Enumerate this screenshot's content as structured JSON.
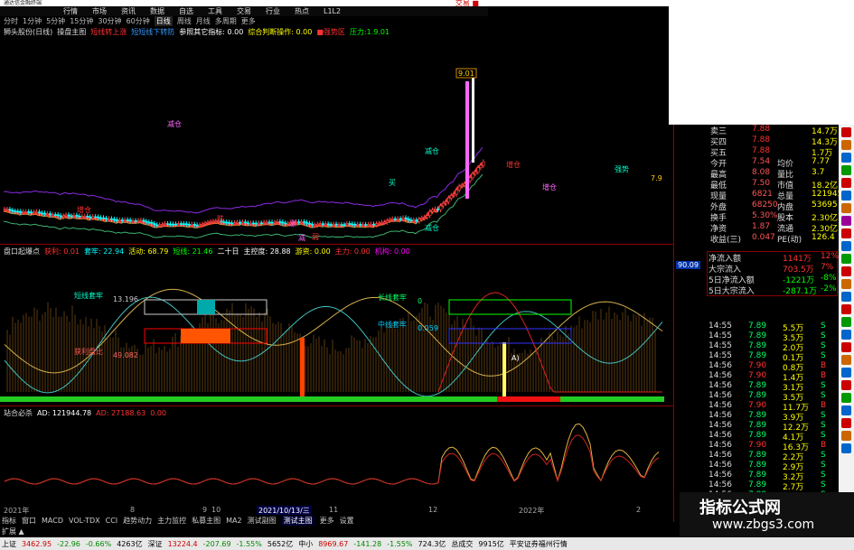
{
  "titlebar": {
    "title": "通达信金融终端",
    "right": "交易 ■"
  },
  "menu": [
    "行情",
    "市场",
    "资讯",
    "数据",
    "自选",
    "工具",
    "交易",
    "行业",
    "热点",
    "L1L2"
  ],
  "toolbar": [
    "分时",
    "1分钟",
    "5分钟",
    "15分钟",
    "30分钟",
    "60分钟",
    "日线",
    "周线",
    "月线",
    "多周期",
    "更多"
  ],
  "toolbar_active": 6,
  "ind1": [
    {
      "t": "狮头股份(日线)",
      "c": "#dddddd"
    },
    {
      "t": "操盘主图",
      "c": "#dddddd"
    },
    {
      "t": "短线转上涨",
      "c": "#ff3333"
    },
    {
      "t": "短短线下转防",
      "c": "#3399ff"
    },
    {
      "t": "参照其它指标: 0.00",
      "c": "#ffffff"
    },
    {
      "t": "综合判断操作: 0.00",
      "c": "#ffff00"
    },
    {
      "t": "■强势区",
      "c": "#ff3333"
    },
    {
      "t": "压力:1.9.01",
      "c": "#00ff00"
    }
  ],
  "ind2": [
    {
      "t": "盘口起爆点",
      "c": "#dddddd"
    },
    {
      "t": "获利: 0.01",
      "c": "#ff3333"
    },
    {
      "t": "套牢: 22.94",
      "c": "#00ffff"
    },
    {
      "t": "活动: 68.79",
      "c": "#ffff00"
    },
    {
      "t": "短线: 21.46",
      "c": "#00ff00"
    },
    {
      "t": "二十日",
      "c": "#ffffff"
    },
    {
      "t": "主控度: 28.88",
      "c": "#ffffff"
    },
    {
      "t": "游资: 0.00",
      "c": "#ffff00"
    },
    {
      "t": "主力: 0.00",
      "c": "#ff3333"
    },
    {
      "t": "机构: 0.00",
      "c": "#ff00ff"
    }
  ],
  "ind3": [
    {
      "t": "站合必杀",
      "c": "#dddddd"
    },
    {
      "t": "AD: 121944.78",
      "c": "#ffffff"
    },
    {
      "t": "AD: 27188.63",
      "c": "#ff3333"
    },
    {
      "t": "0.00",
      "c": "#ff3333"
    }
  ],
  "axis1": [
    "7.75",
    "7.50",
    "7.25",
    "7.00",
    "6.75",
    "6.50"
  ],
  "axis2": [
    "100.00",
    "80.00",
    "60.00",
    "40.00",
    "20.00",
    "0.00"
  ],
  "axis3": [
    "45000",
    "30000",
    "15000",
    "0"
  ],
  "axis2_badge": "90.09",
  "quote_rows": [
    {
      "l": "卖三",
      "v": "7.88",
      "v2": "14.7万",
      "lc": "#ccc",
      "vc": "#ff3333"
    },
    {
      "l": "买四",
      "v": "7.88",
      "v2": "14.3万",
      "lc": "#ccc",
      "vc": "#ff3333"
    },
    {
      "l": "买五",
      "v": "7.88",
      "v2": "1.7万",
      "lc": "#ccc",
      "vc": "#ff3333"
    },
    {
      "l": "今开",
      "v": "7.54",
      "l2": "均价",
      "v3": "7.77"
    },
    {
      "l": "最高",
      "v": "8.08",
      "l2": "量比",
      "v3": "3.7"
    },
    {
      "l": "最低",
      "v": "7.50",
      "l2": "市值",
      "v3": "18.2亿"
    },
    {
      "l": "现量",
      "v": "6821",
      "l2": "总量",
      "v3": "121945"
    },
    {
      "l": "外盘",
      "v": "68250",
      "l2": "内盘",
      "v3": "53695"
    },
    {
      "l": "换手",
      "v": "5.30%",
      "l2": "股本",
      "v3": "2.30亿"
    },
    {
      "l": "净资",
      "v": "1.87",
      "l2": "流通",
      "v3": "2.30亿"
    },
    {
      "l": "收益(三)",
      "v": "0.047",
      "l2": "PE(动)",
      "v3": "126.4"
    }
  ],
  "flow_rows": [
    {
      "l": "净流入额",
      "v": "1141万",
      "p": "12%",
      "vc": "#ff3333"
    },
    {
      "l": "大宗流入",
      "v": "703.5万",
      "p": "7%",
      "vc": "#ff3333"
    },
    {
      "l": "5日净流入额",
      "v": "-1221万",
      "p": "-8%",
      "vc": "#00ff00"
    },
    {
      "l": "5日大宗流入",
      "v": "-287.1万",
      "p": "-2%",
      "vc": "#00ff00"
    }
  ],
  "ticks": [
    {
      "t": "14:55",
      "p": "7.89",
      "v": "5.5万",
      "s": "S"
    },
    {
      "t": "14:55",
      "p": "7.89",
      "v": "3.5万",
      "s": "S"
    },
    {
      "t": "14:55",
      "p": "7.89",
      "v": "2.0万",
      "s": "S"
    },
    {
      "t": "14:55",
      "p": "7.89",
      "v": "0.1万",
      "s": "S"
    },
    {
      "t": "14:56",
      "p": "7.90",
      "v": "0.8万",
      "s": "B"
    },
    {
      "t": "14:56",
      "p": "7.90",
      "v": "1.4万",
      "s": "B"
    },
    {
      "t": "14:56",
      "p": "7.89",
      "v": "3.1万",
      "s": "S"
    },
    {
      "t": "14:56",
      "p": "7.89",
      "v": "3.5万",
      "s": "S"
    },
    {
      "t": "14:56",
      "p": "7.90",
      "v": "11.7万",
      "s": "B"
    },
    {
      "t": "14:56",
      "p": "7.89",
      "v": "3.9万",
      "s": "S"
    },
    {
      "t": "14:56",
      "p": "7.89",
      "v": "12.2万",
      "s": "S"
    },
    {
      "t": "14:56",
      "p": "7.89",
      "v": "4.1万",
      "s": "S"
    },
    {
      "t": "14:56",
      "p": "7.90",
      "v": "16.3万",
      "s": "B"
    },
    {
      "t": "14:56",
      "p": "7.89",
      "v": "2.2万",
      "s": "S"
    },
    {
      "t": "14:56",
      "p": "7.89",
      "v": "2.9万",
      "s": "S"
    },
    {
      "t": "14:56",
      "p": "7.89",
      "v": "3.2万",
      "s": "S"
    },
    {
      "t": "14:56",
      "p": "7.89",
      "v": "2.7万",
      "s": "S"
    },
    {
      "t": "14:56",
      "p": "7.89",
      "v": "2.5万",
      "s": "S"
    },
    {
      "t": "14:56",
      "p": "7.89",
      "v": "4.7万",
      "s": "S"
    }
  ],
  "dates": [
    "2021年",
    "8",
    "9",
    "10",
    "2021/10/13/三",
    "11",
    "12",
    "2022年",
    "2"
  ],
  "tabs": [
    "指标",
    "窗口",
    "MACD",
    "VOL-TDX",
    "CCI",
    "趋势动力",
    "主力监控",
    "私募主图",
    "MA2",
    "测试副图",
    "测试主图",
    "更多",
    "设置"
  ],
  "status": [
    {
      "t": "上证",
      "c": "#000"
    },
    {
      "t": "3462.95",
      "c": "#c00"
    },
    {
      "t": "-22.96",
      "c": "#080"
    },
    {
      "t": "-0.66%",
      "c": "#080"
    },
    {
      "t": "4263亿",
      "c": "#000"
    },
    {
      "t": "深证",
      "c": "#000"
    },
    {
      "t": "13224.4",
      "c": "#c00"
    },
    {
      "t": "-207.69",
      "c": "#080"
    },
    {
      "t": "-1.55%",
      "c": "#080"
    },
    {
      "t": "5652亿",
      "c": "#000"
    },
    {
      "t": "中小",
      "c": "#000"
    },
    {
      "t": "8969.67",
      "c": "#c00"
    },
    {
      "t": "-141.28",
      "c": "#080"
    },
    {
      "t": "-1.55%",
      "c": "#080"
    },
    {
      "t": "724.3亿",
      "c": "#000"
    },
    {
      "t": "总成交",
      "c": "#000"
    },
    {
      "t": "9915亿",
      "c": "#000"
    },
    {
      "t": "平安证券福州行情",
      "c": "#000"
    }
  ],
  "panel_labels": {
    "bottom_left": "扩展 ▲",
    "tab_right": "模板",
    "chart_labels": [
      "短线套牢",
      "获利盘比",
      "长线套牢",
      "中线套牢",
      "13.196",
      "49.082",
      "0",
      "0.059",
      "A)",
      "减仓",
      "减仓",
      "增仓",
      "增仓",
      "买",
      "跌",
      "涨",
      "减仓",
      "增仓",
      "减",
      "强势",
      "弱"
    ],
    "price_tags": [
      "9.01",
      "7.9"
    ]
  },
  "colors": {
    "up": "#ff3333",
    "down": "#00ffff",
    "ma": "#dddd00",
    "bg": "#000000"
  },
  "watermark": {
    "line1": "指标公式网",
    "line2": "www.zbgs3.com"
  }
}
